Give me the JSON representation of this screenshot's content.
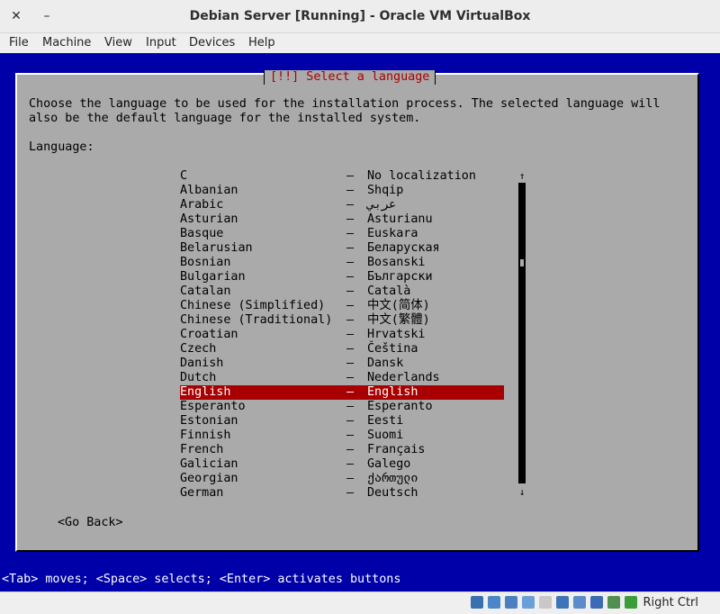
{
  "window": {
    "title": "Debian Server [Running] - Oracle VM VirtualBox",
    "close_glyph": "✕",
    "minimize_glyph": "–"
  },
  "menubar": [
    "File",
    "Machine",
    "View",
    "Input",
    "Devices",
    "Help"
  ],
  "dialog": {
    "title": "[!!] Select a language",
    "description": [
      "Choose the language to be used for the installation process. The selected language will",
      "also be the default language for the installed system."
    ],
    "list_label": "Language:",
    "languages": [
      {
        "name": "C",
        "native": "No localization"
      },
      {
        "name": "Albanian",
        "native": "Shqip"
      },
      {
        "name": "Arabic",
        "native": "عربي"
      },
      {
        "name": "Asturian",
        "native": "Asturianu"
      },
      {
        "name": "Basque",
        "native": "Euskara"
      },
      {
        "name": "Belarusian",
        "native": "Беларуская"
      },
      {
        "name": "Bosnian",
        "native": "Bosanski"
      },
      {
        "name": "Bulgarian",
        "native": "Български"
      },
      {
        "name": "Catalan",
        "native": "Català"
      },
      {
        "name": "Chinese (Simplified)",
        "native": "中文(简体)"
      },
      {
        "name": "Chinese (Traditional)",
        "native": "中文(繁體)"
      },
      {
        "name": "Croatian",
        "native": "Hrvatski"
      },
      {
        "name": "Czech",
        "native": "Čeština"
      },
      {
        "name": "Danish",
        "native": "Dansk"
      },
      {
        "name": "Dutch",
        "native": "Nederlands"
      },
      {
        "name": "English",
        "native": "English"
      },
      {
        "name": "Esperanto",
        "native": "Esperanto"
      },
      {
        "name": "Estonian",
        "native": "Eesti"
      },
      {
        "name": "Finnish",
        "native": "Suomi"
      },
      {
        "name": "French",
        "native": "Français"
      },
      {
        "name": "Galician",
        "native": "Galego"
      },
      {
        "name": "Georgian",
        "native": "ქართული"
      },
      {
        "name": "German",
        "native": "Deutsch"
      }
    ],
    "separator": "–",
    "selected_language": "English",
    "scroll_up": "↑",
    "scroll_down": "↓",
    "go_back": "<Go Back>"
  },
  "status_line": "<Tab> moves; <Space> selects; <Enter> activates buttons",
  "vbox_status": {
    "host_key": "Right Ctrl",
    "icons": [
      {
        "name": "hard-disk-icon",
        "color": "#3a6fb0"
      },
      {
        "name": "optical-drive-icon",
        "color": "#4a86c8"
      },
      {
        "name": "network-icon",
        "color": "#4c7fc0"
      },
      {
        "name": "usb-icon",
        "color": "#6a9fd8"
      },
      {
        "name": "shared-folders-icon",
        "color": "#c8c8c8"
      },
      {
        "name": "display-icon",
        "color": "#3f74b8"
      },
      {
        "name": "video-capture-icon",
        "color": "#5a8ccc"
      },
      {
        "name": "vt-x-icon",
        "color": "#3b6bb4"
      },
      {
        "name": "mouse-integration-icon",
        "color": "#4f8f4f"
      },
      {
        "name": "guest-additions-icon",
        "color": "#3c9c3c"
      }
    ]
  }
}
